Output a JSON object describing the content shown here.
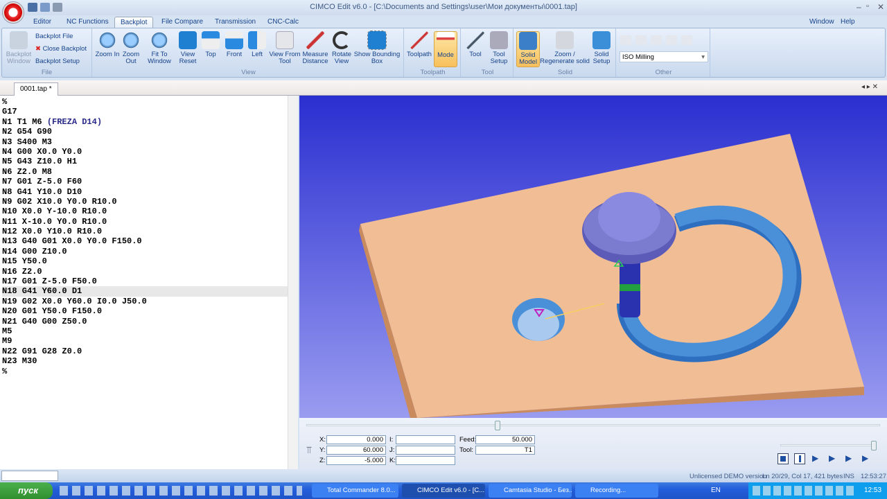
{
  "window": {
    "title": "CIMCO Edit v6.0 - [C:\\Documents and Settings\\user\\Мои документы\\0001.tap]"
  },
  "menu_right": {
    "window": "Window",
    "help": "Help"
  },
  "tabs": [
    "Editor",
    "NC Functions",
    "Backplot",
    "File Compare",
    "Transmission",
    "CNC-Calc"
  ],
  "active_tab": "Backplot",
  "ribbon": {
    "file": {
      "label": "File",
      "backplot_window": "Backplot Window",
      "backplot_file": "Backplot File",
      "close_backplot": "Close Backplot",
      "backplot_setup": "Backplot Setup"
    },
    "view": {
      "label": "View",
      "buttons": [
        "Zoom In",
        "Zoom Out",
        "Fit To Window",
        "View Reset",
        "Top",
        "Front",
        "Left",
        "View From Tool",
        "Measure Distance",
        "Rotate View",
        "Show Bounding Box"
      ]
    },
    "toolpath": {
      "label": "Toolpath",
      "buttons": [
        "Toolpath",
        "Mode"
      ]
    },
    "tool": {
      "label": "Tool",
      "buttons": [
        "Tool",
        "Tool Setup"
      ]
    },
    "solid": {
      "label": "Solid",
      "buttons": [
        "Solid Model",
        "Zoom / Regenerate solid",
        "Solid Setup"
      ]
    },
    "other": {
      "label": "Other",
      "machine": "ISO Milling"
    }
  },
  "document_tab": "0001.tap *",
  "code_lines": [
    "%",
    "G17",
    "N1 T1 M6 (FREZA D14)",
    "N2 G54 G90",
    "N3 S400 M3",
    "N4 G00 X0.0 Y0.0",
    "N5 G43 Z10.0 H1",
    "N6 Z2.0 M8",
    "N7 G01 Z-5.0 F60",
    "N8 G41 Y10.0 D10",
    "N9 G02 X10.0 Y0.0 R10.0",
    "N10 X0.0 Y-10.0 R10.0",
    "N11 X-10.0 Y0.0 R10.0",
    "N12 X0.0 Y10.0 R10.0",
    "N13 G40 G01 X0.0 Y0.0 F150.0",
    "N14 G00 Z10.0",
    "N15 Y50.0",
    "N16 Z2.0",
    "N17 G01 Z-5.0 F50.0",
    "N18 G41 Y60.0 D1",
    "N19 G02 X0.0 Y60.0 I0.0 J50.0",
    "N20 G01 Y50.0 F150.0",
    "N21 G40 G00 Z50.0",
    "M5",
    "M9",
    "N22 G91 G28 Z0.0",
    "N23 M30",
    "%"
  ],
  "highlighted_line": 19,
  "readout": {
    "x_label": "X:",
    "x": "0.000",
    "y_label": "Y:",
    "y": "60.000",
    "z_label": "Z:",
    "z": "-5.000",
    "i_label": "I:",
    "i": "",
    "j_label": "J:",
    "j": "",
    "k_label": "K:",
    "k": "",
    "feed_label": "Feed:",
    "feed": "50.000",
    "tool_label": "Tool:",
    "tool": "T1"
  },
  "playback_progress": 0.33,
  "speed_level": 1.0,
  "status": {
    "license": "Unlicensed DEMO version",
    "position": "Ln 20/29, Col 17, 421 bytes",
    "mode": "INS",
    "time": "12:53:27"
  },
  "taskbar": {
    "start": "пуск",
    "tasks": [
      "Total Commander 8.0...",
      "CIMCO Edit v6.0 - [C...",
      "Camtasia Studio - Без...",
      "Recording..."
    ],
    "lang": "EN",
    "clock": "12:53"
  },
  "colors": {
    "viewport_top": "#2a2fd0",
    "viewport_bottom": "#9a9cf0",
    "stock": "#f1bd95",
    "cut": "#4a90d9",
    "tool": "#7b7bd0"
  }
}
